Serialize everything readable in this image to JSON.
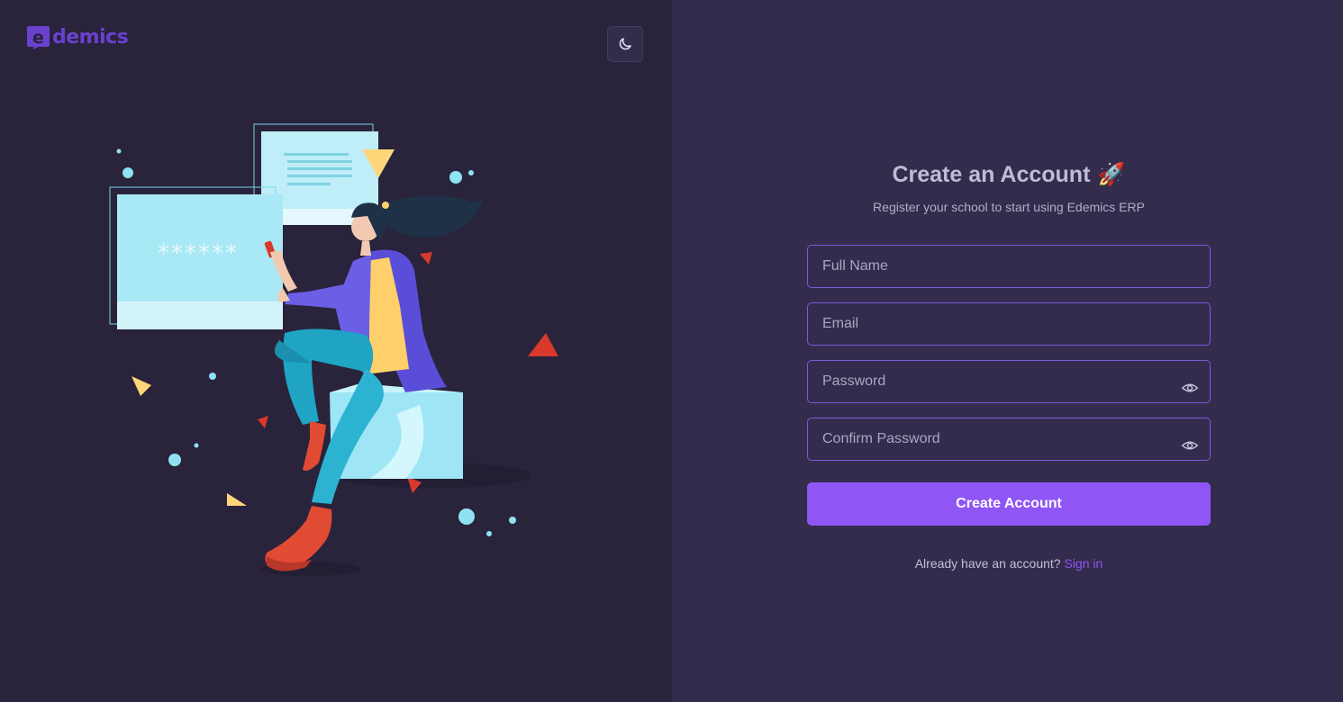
{
  "brand": {
    "name": "demics",
    "logo_letter": "e",
    "accent": "#6a41cf"
  },
  "header": {
    "theme_toggle_icon": "moon-icon"
  },
  "illustration": {
    "password_mask": "******"
  },
  "form": {
    "title": "Create an Account",
    "title_emoji": "🚀",
    "subtitle": "Register your school to start using Edemics ERP",
    "fields": {
      "full_name": {
        "placeholder": "Full Name",
        "value": ""
      },
      "email": {
        "placeholder": "Email",
        "value": ""
      },
      "password": {
        "placeholder": "Password",
        "value": "",
        "toggle_icon": "eye-icon"
      },
      "confirm_password": {
        "placeholder": "Confirm Password",
        "value": "",
        "toggle_icon": "eye-icon"
      }
    },
    "submit_label": "Create Account",
    "signin_prompt": "Already have an account?",
    "signin_link": "Sign in"
  },
  "colors": {
    "primary": "#8f55f5",
    "border": "#7b5ae0",
    "left_bg": "#29233c",
    "right_bg": "#332c4c"
  }
}
